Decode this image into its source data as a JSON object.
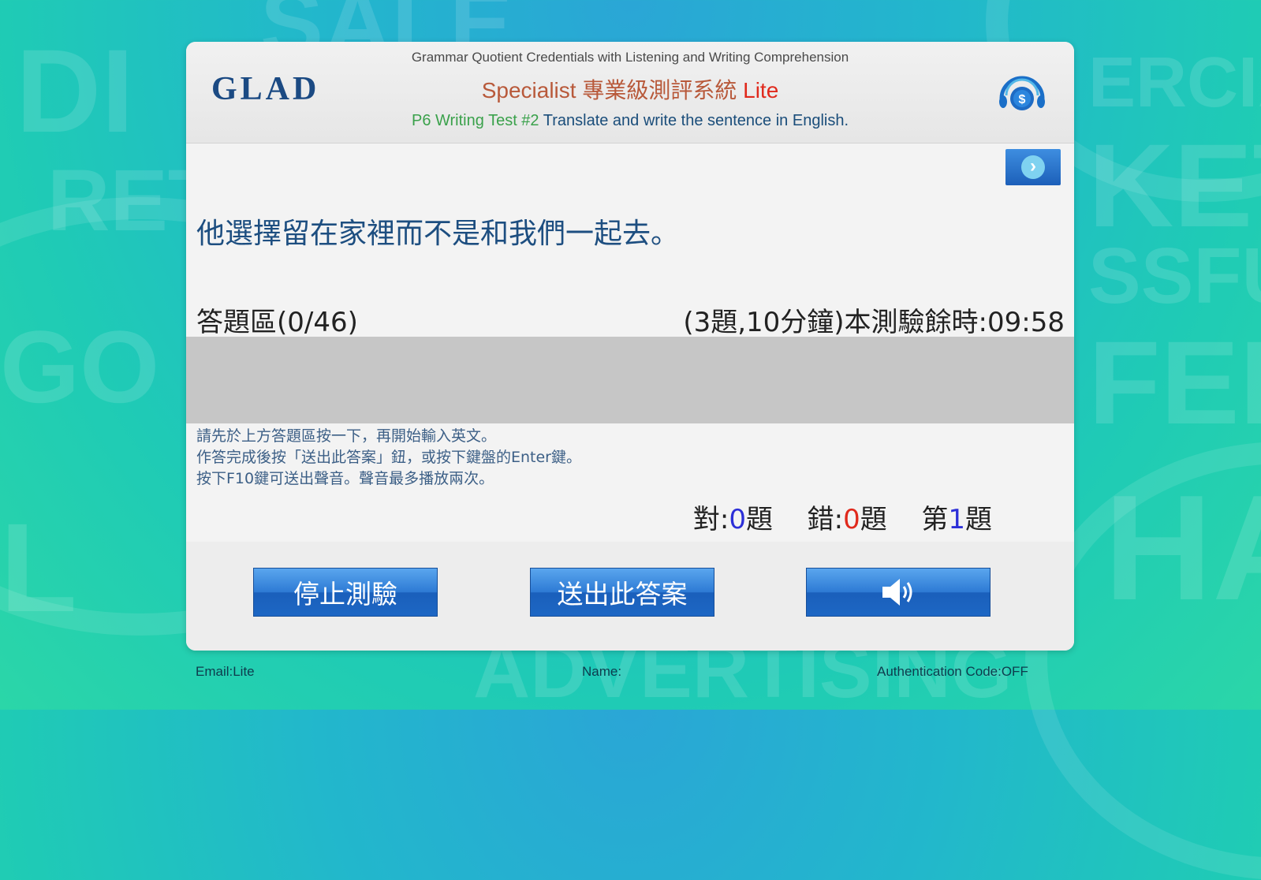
{
  "header": {
    "logo": "GLAD",
    "subtitle": "Grammar Quotient Credentials with Listening and Writing Comprehension",
    "title_main": "Specialist 專業級測評系統",
    "title_lite": "Lite",
    "test_name": "P6 Writing Test #2",
    "instruction": "Translate and write the sentence in English."
  },
  "question": {
    "text": "他選擇留在家裡而不是和我們一起去。"
  },
  "answer": {
    "label": "答題區(0/46)",
    "timer": "(3題,10分鐘)本測驗餘時:09:58",
    "value": ""
  },
  "instructions": [
    "請先於上方答題區按一下，再開始輸入英文。",
    "作答完成後按「送出此答案」鈕，或按下鍵盤的Enter鍵。",
    "按下F10鍵可送出聲音。聲音最多播放兩次。"
  ],
  "score": {
    "correct_label": "對:",
    "correct_value": "0",
    "correct_unit": "題",
    "wrong_label": "錯:",
    "wrong_value": "0",
    "wrong_unit": "題",
    "question_prefix": "第",
    "question_value": "1",
    "question_unit": "題"
  },
  "buttons": {
    "stop": "停止測驗",
    "submit": "送出此答案",
    "sound_icon": "speaker-icon"
  },
  "footer": {
    "email": "Email:Lite",
    "name": "Name:",
    "auth": "Authentication Code:OFF"
  },
  "colors": {
    "brand_blue": "#1b4a83",
    "button_blue": "#2d7ad4",
    "correct_blue": "#2c2fd8",
    "wrong_red": "#e0291c"
  }
}
